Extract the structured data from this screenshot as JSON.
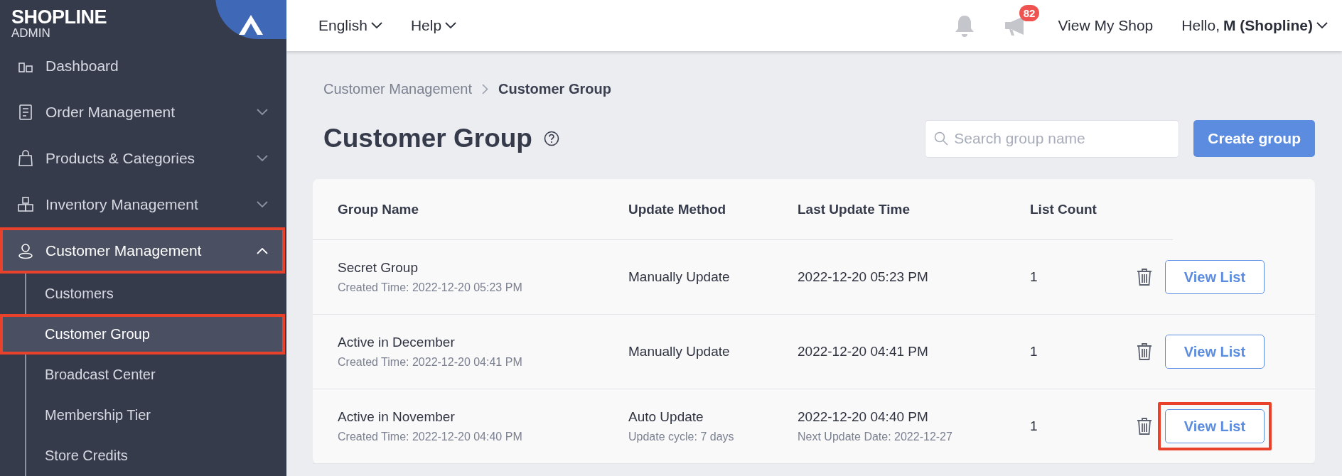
{
  "sidebar": {
    "logo": {
      "brand": "SHOPLINE",
      "subtitle": "ADMIN"
    },
    "items": [
      {
        "label": "Dashboard",
        "selected": false,
        "highlighted": false
      },
      {
        "label": "Order Management",
        "expanded": false,
        "selected": false,
        "highlighted": false
      },
      {
        "label": "Products & Categories",
        "expanded": false,
        "selected": false,
        "highlighted": false
      },
      {
        "label": "Inventory Management",
        "expanded": false,
        "selected": false,
        "highlighted": false
      },
      {
        "label": "Customer Management",
        "expanded": true,
        "selected": true,
        "highlighted": true,
        "children": [
          {
            "label": "Customers",
            "selected": false,
            "highlighted": false
          },
          {
            "label": "Customer Group",
            "selected": true,
            "highlighted": true
          },
          {
            "label": "Broadcast Center",
            "selected": false,
            "highlighted": false
          },
          {
            "label": "Membership Tier",
            "selected": false,
            "highlighted": false
          },
          {
            "label": "Store Credits",
            "selected": false,
            "highlighted": false
          }
        ]
      }
    ]
  },
  "topbar": {
    "menus": [
      "English",
      "Help"
    ],
    "notification_badge": "82",
    "view_shop": "View My Shop",
    "greeting": "Hello,",
    "user": "M (Shopline)"
  },
  "breadcrumb": [
    "Customer Management",
    "Customer Group"
  ],
  "page_title": "Customer Group",
  "search": {
    "placeholder": "Search group name"
  },
  "create_button": "Create group",
  "table": {
    "columns": [
      "Group Name",
      "Update Method",
      "Last Update Time",
      "List Count"
    ],
    "rows": [
      {
        "name": "Secret Group",
        "created": "Created Time: 2022-12-20 05:23 PM",
        "method": "Manually Update",
        "last_update": "2022-12-20 05:23 PM",
        "count": "1",
        "action": "View List",
        "highlighted": false
      },
      {
        "name": "Active in December",
        "created": "Created Time: 2022-12-20 04:41 PM",
        "method": "Manually Update",
        "last_update": "2022-12-20 04:41 PM",
        "count": "1",
        "action": "View List",
        "highlighted": false
      },
      {
        "name": "Active in November",
        "created": "Created Time: 2022-12-20 04:40 PM",
        "method": "Auto Update",
        "method_note": "Update cycle: 7 days",
        "last_update": "2022-12-20 04:40 PM",
        "next_update": "Next Update Date: 2022-12-27",
        "count": "1",
        "action": "View List",
        "highlighted": true
      }
    ]
  }
}
